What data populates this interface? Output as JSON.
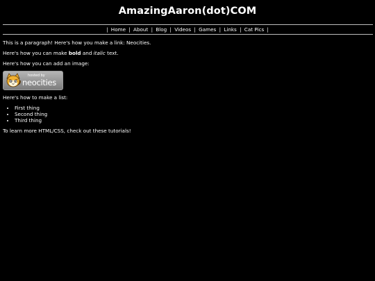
{
  "header": {
    "title": "AmazingAaron(dot)COM"
  },
  "nav": {
    "open_sep": "|",
    "items": [
      {
        "label": "Home"
      },
      {
        "label": "About"
      },
      {
        "label": "Blog"
      },
      {
        "label": "Videos"
      },
      {
        "label": "Games"
      },
      {
        "label": "Links"
      },
      {
        "label": "Cat Pics"
      }
    ],
    "separator": "|"
  },
  "content": {
    "para1_text": "This is a paragraph! Here's how you make a link: ",
    "para1_link": "Neocities",
    "para1_end": ".",
    "para2_start": "Here's how you can make ",
    "para2_bold": "bold",
    "para2_mid": " and ",
    "para2_italic": "italic",
    "para2_end": " text.",
    "para3": "Here's how you can add an image:",
    "badge": {
      "hosted_text": "hosted by",
      "brand_text": "neocities",
      "icon": "neocities-cat-icon"
    },
    "para4": "Here's how to make a list:",
    "list": [
      "First thing",
      "Second thing",
      "Third thing"
    ],
    "para5": "To learn more HTML/CSS, check out these tutorials!"
  }
}
